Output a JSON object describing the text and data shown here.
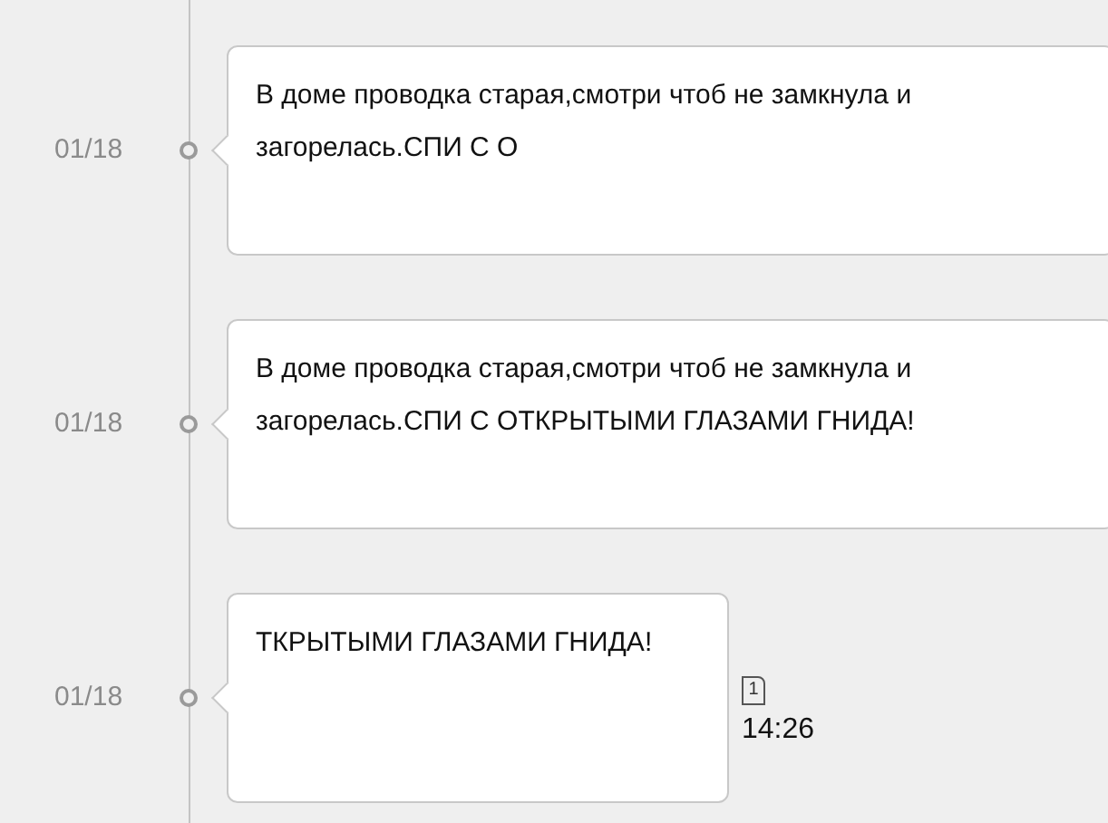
{
  "messages": [
    {
      "date": "01/18",
      "text": "В доме проводка старая,смотри чтоб не замкнула и загорелась.СПИ С О"
    },
    {
      "date": "01/18",
      "text": "В доме проводка старая,смотри чтоб не замкнула и загорелась.СПИ С ОТКРЫТЫМИ ГЛАЗАМИ ГНИДА!"
    },
    {
      "date": "01/18",
      "text": "ТКРЫТЫМИ ГЛАЗАМИ ГНИДА!",
      "sim": "1",
      "time": "14:26"
    }
  ]
}
